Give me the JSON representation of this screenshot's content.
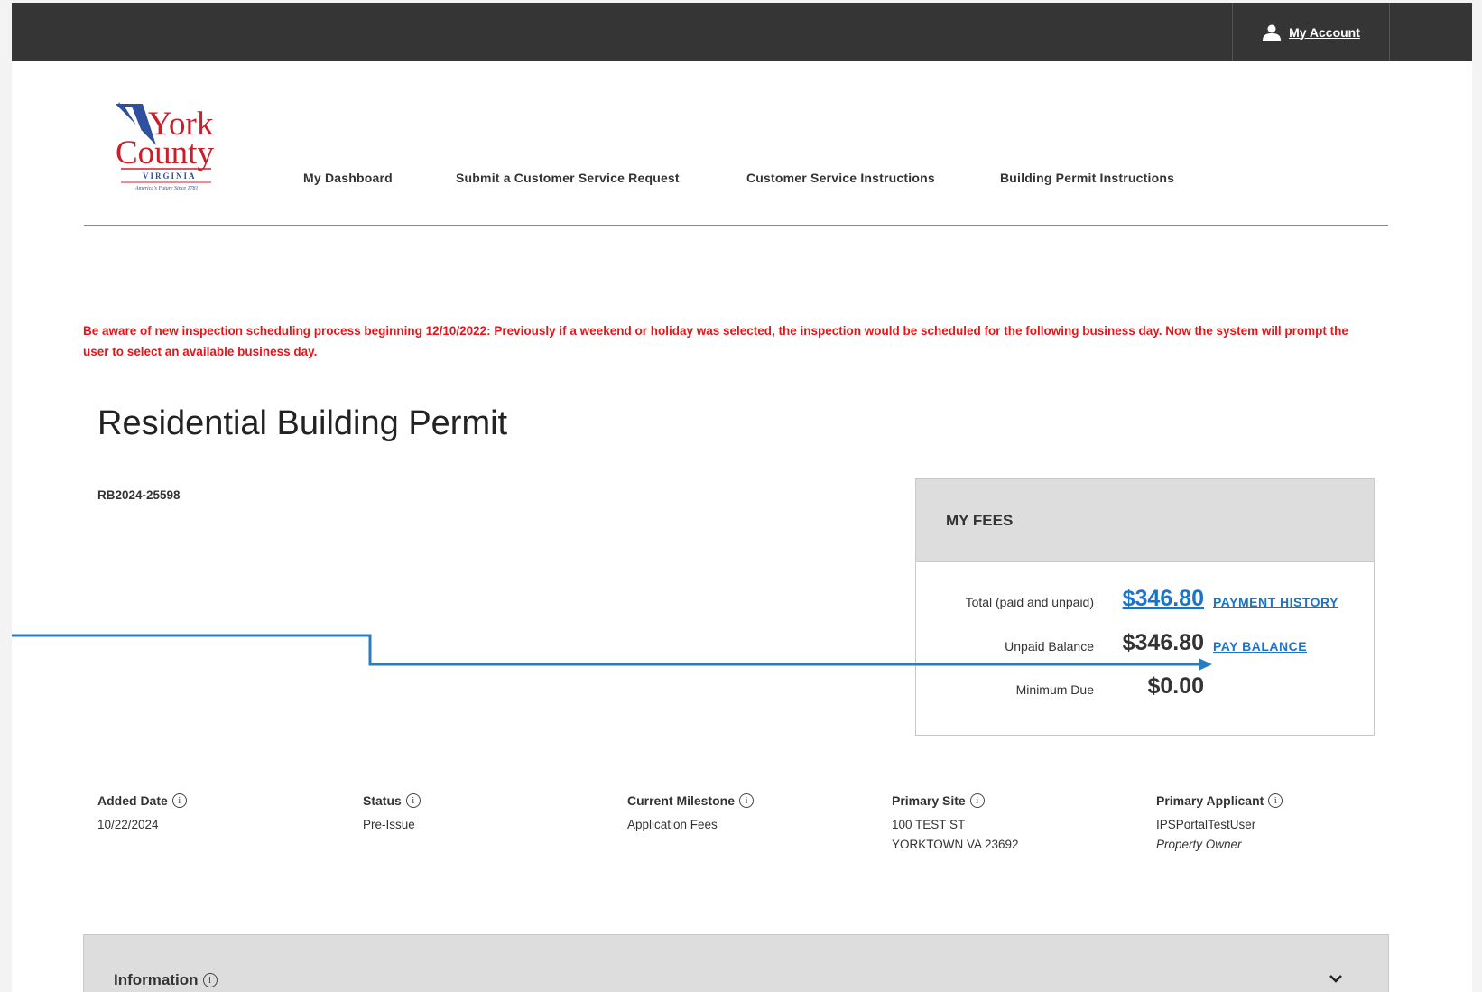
{
  "topbar": {
    "account_label": "My Account",
    "account_icon": "user-icon"
  },
  "logo": {
    "line1": "York",
    "line2": "County",
    "line3": "VIRGINIA",
    "tagline": "America's Future Since 1781"
  },
  "nav": {
    "items": [
      {
        "label": "My Dashboard"
      },
      {
        "label": "Submit a Customer Service Request"
      },
      {
        "label": "Customer Service Instructions"
      },
      {
        "label": "Building Permit Instructions"
      }
    ]
  },
  "notice": "Be aware of new inspection scheduling process beginning 12/10/2022: Previously if a weekend or holiday was selected, the inspection would be scheduled for the following business day.  Now the system will prompt the user to select an available business day.",
  "page": {
    "title": "Residential Building Permit",
    "permit_number": "RB2024-25598"
  },
  "fees": {
    "heading": "MY FEES",
    "rows": [
      {
        "label": "Total (paid and unpaid)",
        "amount": "$346.80",
        "link": "PAYMENT HISTORY"
      },
      {
        "label": "Unpaid Balance",
        "amount": "$346.80",
        "link": "PAY BALANCE"
      },
      {
        "label": "Minimum Due",
        "amount": "$0.00"
      }
    ]
  },
  "details": {
    "added_date": {
      "label": "Added Date",
      "value": "10/22/2024"
    },
    "status": {
      "label": "Status",
      "value": "Pre-Issue"
    },
    "milestone": {
      "label": "Current Milestone",
      "value": "Application Fees"
    },
    "site": {
      "label": "Primary Site",
      "line1": "100 TEST ST",
      "line2": "YORKTOWN VA 23692"
    },
    "applicant": {
      "label": "Primary Applicant",
      "name": "IPSPortalTestUser",
      "role": "Property Owner"
    }
  },
  "information_section": {
    "label": "Information"
  },
  "colors": {
    "topbar": "#353535",
    "notice": "#e3161b",
    "link": "#1a74c7",
    "annotation": "#2a7bc0"
  }
}
